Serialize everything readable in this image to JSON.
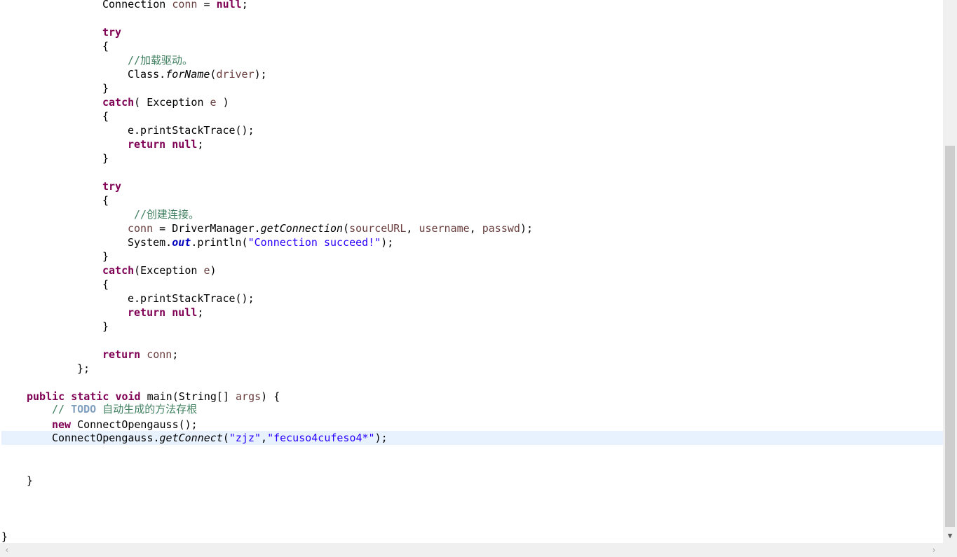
{
  "code": {
    "l01": {
      "a": "Connection ",
      "b": "conn",
      "c": " = ",
      "d": "null",
      "e": ";"
    },
    "l03": "try",
    "l04": "{",
    "l05": "//加载驱动。",
    "l06": {
      "a": "Class.",
      "b": "forName",
      "c": "(",
      "d": "driver",
      "e": ");"
    },
    "l07": "}",
    "l08": {
      "a": "catch",
      "b": "( Exception ",
      "c": "e",
      "d": " )"
    },
    "l09": "{",
    "l10": "e.printStackTrace();",
    "l11": {
      "a": "return",
      "b": " ",
      "c": "null",
      "d": ";"
    },
    "l12": "}",
    "l14": "try",
    "l15": "{",
    "l16": "//创建连接。",
    "l17": {
      "a": "conn",
      "b": " = DriverManager.",
      "c": "getConnection",
      "d": "(",
      "e": "sourceURL",
      "f": ", ",
      "g": "username",
      "h": ", ",
      "i": "passwd",
      "j": ");"
    },
    "l18": {
      "a": "System.",
      "b": "out",
      "c": ".println(",
      "d": "\"Connection succeed!\"",
      "e": ");"
    },
    "l19": "}",
    "l20": {
      "a": "catch",
      "b": "(Exception ",
      "c": "e",
      "d": ")"
    },
    "l21": "{",
    "l22": "e.printStackTrace();",
    "l23": {
      "a": "return",
      "b": " ",
      "c": "null",
      "d": ";"
    },
    "l24": "}",
    "l26": {
      "a": "return",
      "b": " ",
      "c": "conn",
      "d": ";"
    },
    "l27": "};",
    "l29": {
      "a": "public",
      "b": " ",
      "c": "static",
      "d": " ",
      "e": "void",
      "f": " main(String[] ",
      "g": "args",
      "h": ") {"
    },
    "l30": {
      "a": "// ",
      "b": "TODO",
      "c": " 自动生成的方法存根"
    },
    "l31": {
      "a": "new",
      "b": " ConnectOpengauss();"
    },
    "l32": {
      "a": "ConnectOpengauss.",
      "b": "getConnect",
      "c": "(",
      "d": "\"zjz\"",
      "e": ",",
      "f": "\"fecuso4cufeso4*\"",
      "g": ");"
    },
    "l35": "}",
    "l39": "}"
  },
  "scrollbars": {
    "down_arrow": "▼",
    "left_arrow": "‹",
    "right_arrow": "›"
  }
}
